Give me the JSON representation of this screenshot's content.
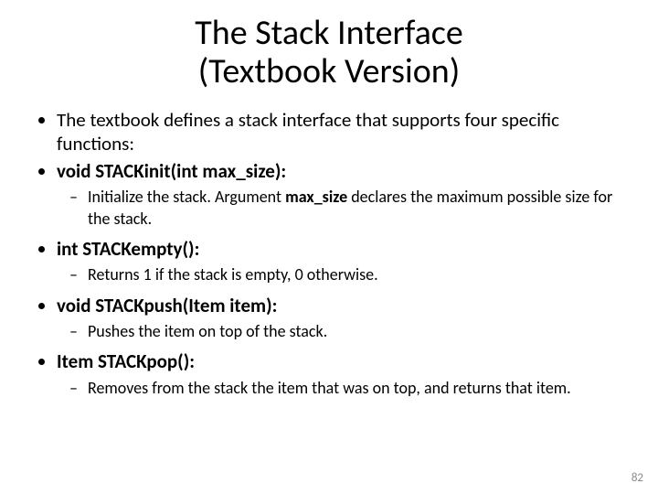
{
  "title_line1": "The Stack Interface",
  "title_line2": "(Textbook Version)",
  "bullets": {
    "intro": "The textbook defines a stack interface that supports four specific functions:",
    "fn1": "void STACKinit(int max_size):",
    "fn1_desc_a": "Initialize the stack. Argument ",
    "fn1_desc_bold": "max_size",
    "fn1_desc_b": " declares the maximum possible size for the stack.",
    "fn2": "int STACKempty():",
    "fn2_desc": "Returns 1 if the stack is empty, 0 otherwise.",
    "fn3": "void STACKpush(Item item):",
    "fn3_desc": "Pushes the item on top of the stack.",
    "fn4": "Item STACKpop():",
    "fn4_desc": "Removes from the stack the item that was on top, and returns that item."
  },
  "page_number": "82"
}
